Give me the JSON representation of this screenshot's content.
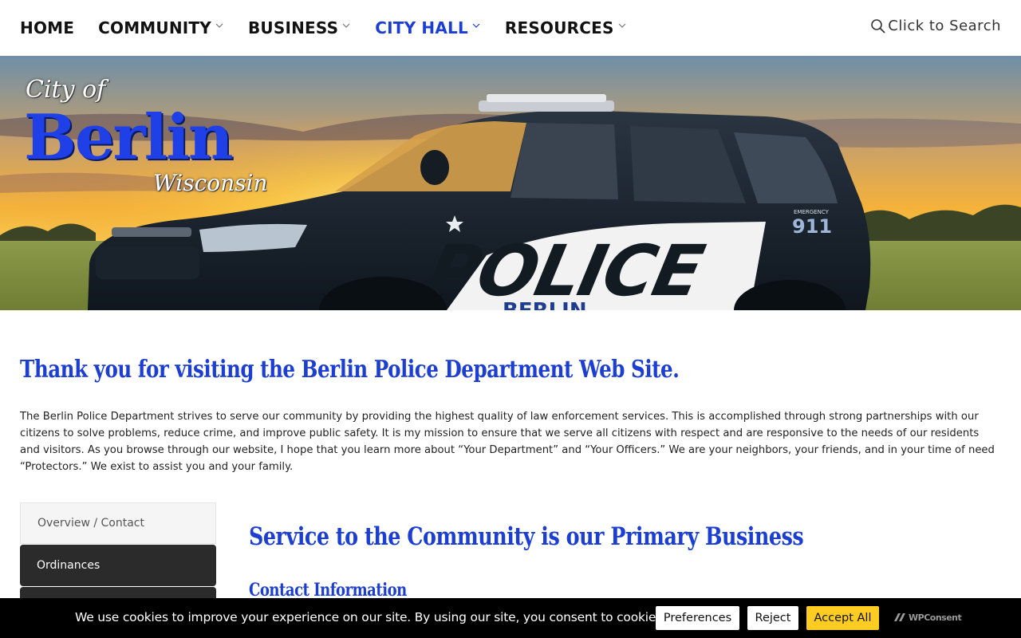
{
  "nav": {
    "items": [
      {
        "label": "HOME",
        "has_dropdown": false,
        "active": false
      },
      {
        "label": "COMMUNITY",
        "has_dropdown": true,
        "active": false
      },
      {
        "label": "BUSINESS",
        "has_dropdown": true,
        "active": false
      },
      {
        "label": "CITY HALL",
        "has_dropdown": true,
        "active": true
      },
      {
        "label": "RESOURCES",
        "has_dropdown": true,
        "active": false
      }
    ],
    "search_label": "Click to Search",
    "active_color": "#1d3fd1"
  },
  "hero": {
    "logo_city_of": "City of",
    "logo_name": "Berlin",
    "logo_state": "Wisconsin",
    "car_text": "POLICE",
    "car_emergency": "911",
    "car_emergency_label": "EMERGENCY",
    "car_partial_text": "BERLIN"
  },
  "main": {
    "title": "Thank you for visiting the Berlin Police Department Web Site.",
    "intro": "The Berlin Police Department strives to serve our community by providing the highest quality of law enforcement services. This is accomplished through strong partnerships with our citizens to solve problems, reduce crime, and improve public safety. It is my mission to ensure that we serve all citizens with respect and are responsive to the needs of our residents and visitors. As you browse through our website, I hope that you learn more about “Your Department” and “Your Officers.” We are your neighbors, your friends, and in your time of need “Protectors.” We exist to assist you and your family.",
    "section_title": "Service to the Community is our Primary Business",
    "subsection_title": "Contact Information"
  },
  "sidebar": {
    "items": [
      {
        "label": "Overview / Contact"
      },
      {
        "label": "Ordinances"
      },
      {
        "label": ""
      }
    ]
  },
  "cookie": {
    "message": "We use cookies to improve your experience on our site. By using our site, you consent to cookies.",
    "preferences_label": "Preferences",
    "reject_label": "Reject",
    "accept_label": "Accept All",
    "brand": "WPConsent",
    "accept_color": "#ffcc22"
  },
  "colors": {
    "brand_blue": "#1d3fd1",
    "cookie_bg": "#000000",
    "sidebar_dark": "#2b2b2b"
  }
}
